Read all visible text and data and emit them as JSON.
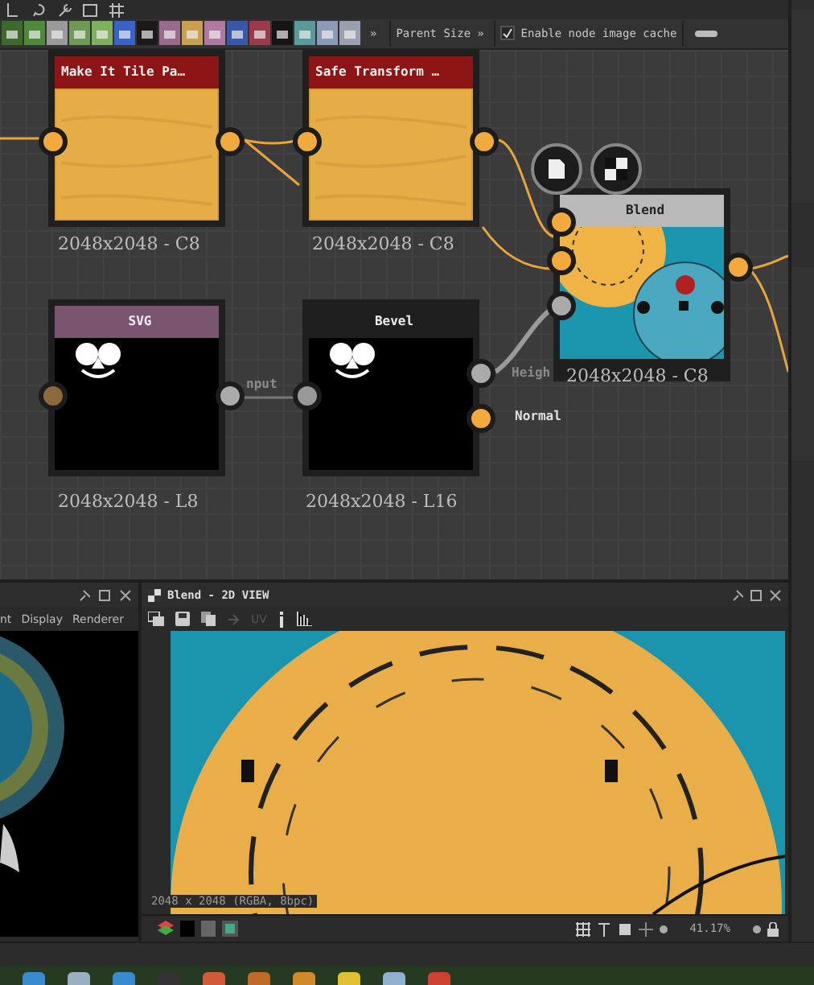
{
  "node_toolbar": {
    "icons": [
      {
        "color": "#3c6a2c"
      },
      {
        "color": "#4f8a3a"
      },
      {
        "color": "#9a9a9a"
      },
      {
        "color": "#6f9a55"
      },
      {
        "color": "#7fb05f"
      },
      {
        "color": "#3a63c8"
      },
      {
        "color": "#1a1a1a"
      },
      {
        "color": "#9a6a8a"
      },
      {
        "color": "#c8a050"
      },
      {
        "color": "#b07aa0"
      },
      {
        "color": "#3a58a8"
      },
      {
        "color": "#9a3a4a"
      },
      {
        "color": "#151515"
      },
      {
        "color": "#5a9a9a"
      },
      {
        "color": "#8a9ab8"
      },
      {
        "color": "#9aa0b0"
      }
    ],
    "more": "»",
    "parent_size": "Parent Size",
    "parent_more": "»",
    "cache": {
      "label": "Enable node image cache",
      "checked": true
    }
  },
  "graph": {
    "nodes": [
      {
        "kind": "atomic",
        "title": "Make It Tile Pa…",
        "resolution": "2048x2048 - C8"
      },
      {
        "kind": "atomic",
        "title": "Safe Transform …",
        "resolution": "2048x2048 - C8"
      },
      {
        "kind": "blend",
        "title": "Blend",
        "resolution": "2048x2048 - C8"
      },
      {
        "kind": "generator",
        "title": "SVG",
        "resolution": "2048x2048 - L8"
      },
      {
        "kind": "filter",
        "title": "Bevel",
        "resolution": "2048x2048 - L16"
      }
    ],
    "pin_labels": [
      "nput",
      "Heigh",
      "Normal"
    ]
  },
  "left_panel": {
    "menu": [
      "nt",
      "Display",
      "Renderer"
    ]
  },
  "view_2d": {
    "title": "Blend - 2D VIEW",
    "tool_text": [
      "UV"
    ],
    "overlay": "2048 x 2048 (RGBA, 8bpc)",
    "zoom": "41.17%"
  }
}
